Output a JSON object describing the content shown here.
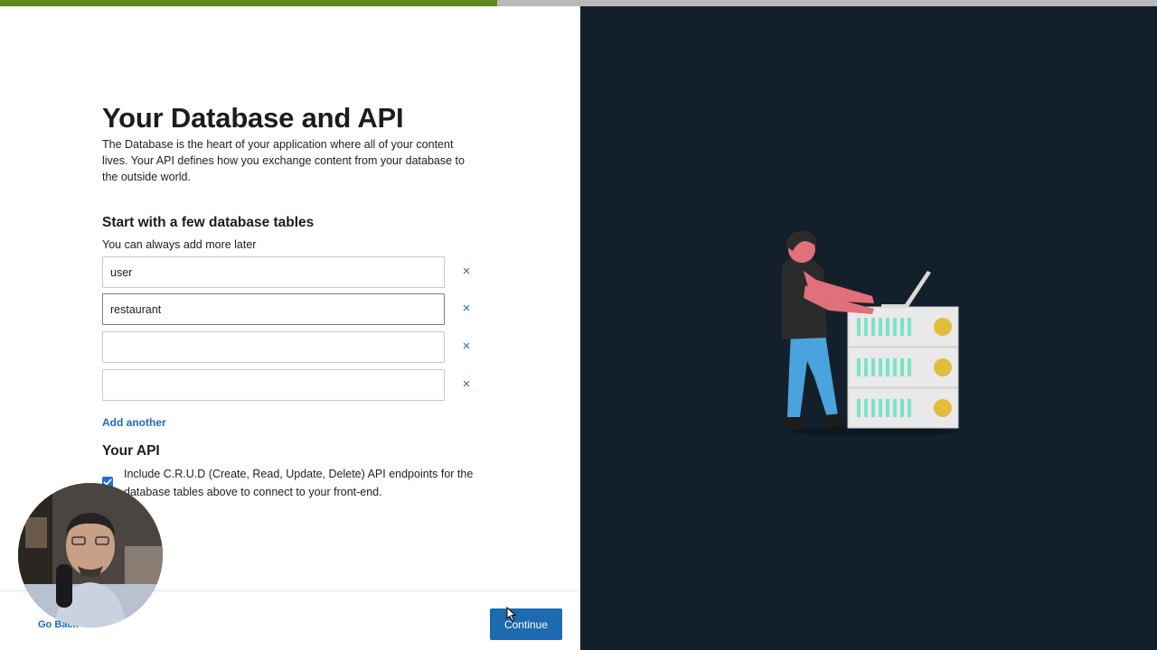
{
  "progress": {
    "percent": 43
  },
  "colors": {
    "progress_fill": "#5b8a1e",
    "progress_track": "#b9b9b9",
    "right_panel_bg": "#13202c",
    "accent_blue": "#1d6ab0",
    "server_dot": "#e2bd3d",
    "server_bars": "#7be3c9",
    "person_skin": "#e0707a",
    "person_pants": "#4aa3dc"
  },
  "page": {
    "title": "Your Database and API",
    "intro": "The Database is the heart of your application where all of your content lives. Your API defines how you exchange content from your database to the outside world."
  },
  "tables_section": {
    "title": "Start with a few database tables",
    "subtitle": "You can always add more later",
    "inputs": [
      {
        "value": "user",
        "remove_icon": "close-icon"
      },
      {
        "value": "restaurant",
        "remove_icon": "close-icon"
      },
      {
        "value": "",
        "remove_icon": "close-icon"
      },
      {
        "value": "",
        "remove_icon": "close-icon"
      }
    ],
    "remove_glyph": "×",
    "add_label": "Add another"
  },
  "api_section": {
    "title": "Your API",
    "checkbox_checked": true,
    "checkbox_label": "Include C.R.U.D (Create, Read, Update, Delete) API endpoints for the database tables above to connect to your front-end."
  },
  "footer": {
    "back_label": "Go Back",
    "continue_label": "Continue"
  }
}
